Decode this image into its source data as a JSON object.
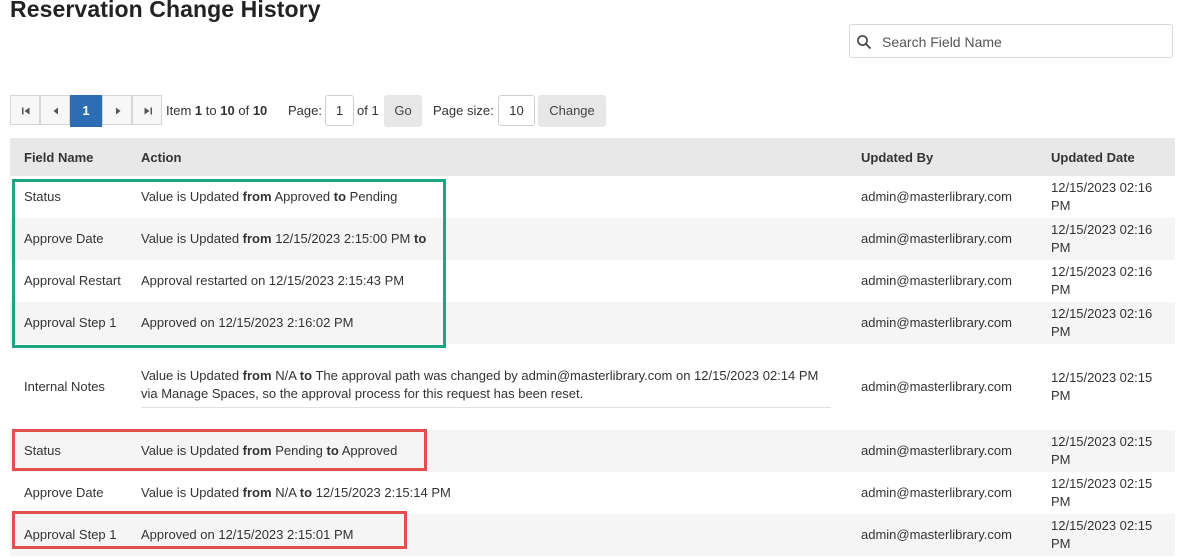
{
  "page": {
    "title": "Reservation Change History"
  },
  "search": {
    "placeholder": "Search Field Name",
    "icon": "search-icon"
  },
  "pager": {
    "current_page": "1",
    "item_label": "Item",
    "item_from": "1",
    "item_to_word": "to",
    "item_to": "10",
    "item_of_word": "of",
    "item_total": "10",
    "page_label": "Page:",
    "page_value": "1",
    "page_of": "of 1",
    "go_label": "Go",
    "size_label": "Page size:",
    "size_value": "10",
    "change_label": "Change"
  },
  "table": {
    "headers": {
      "field": "Field Name",
      "action": "Action",
      "by": "Updated By",
      "date": "Updated Date"
    },
    "rows": [
      {
        "field": "Status",
        "a1": "Value is Updated",
        "k1": "from",
        "a2": "Approved",
        "k2": "to",
        "a3": "Pending",
        "by": "admin@masterlibrary.com",
        "date": "12/15/2023 02:16 PM"
      },
      {
        "field": "Approve Date",
        "a1": "Value is Updated",
        "k1": "from",
        "a2": "12/15/2023 2:15:00 PM",
        "k2": "to",
        "a3": "",
        "by": "admin@masterlibrary.com",
        "date": "12/15/2023 02:16 PM"
      },
      {
        "field": "Approval Restart",
        "a1": "Approval restarted on 12/15/2023 2:15:43 PM",
        "by": "admin@masterlibrary.com",
        "date": "12/15/2023 02:16 PM"
      },
      {
        "field": "Approval Step 1",
        "a1": "Approved on 12/15/2023 2:16:02 PM",
        "by": "admin@masterlibrary.com",
        "date": "12/15/2023 02:16 PM"
      },
      {
        "field": "Internal Notes",
        "a1": "Value is Updated",
        "k1": "from",
        "a2": "N/A",
        "k2": "to",
        "a3": "The approval path was changed by admin@masterlibrary.com on 12/15/2023 02:14 PM via Manage Spaces, so the approval process for this request has been reset.",
        "by": "admin@masterlibrary.com",
        "date": "12/15/2023 02:15 PM"
      },
      {
        "field": "Status",
        "a1": "Value is Updated",
        "k1": "from",
        "a2": "Pending",
        "k2": "to",
        "a3": "Approved",
        "by": "admin@masterlibrary.com",
        "date": "12/15/2023 02:15 PM"
      },
      {
        "field": "Approve Date",
        "a1": "Value is Updated",
        "k1": "from",
        "a2": "N/A",
        "k2": "to",
        "a3": "12/15/2023 2:15:14 PM",
        "by": "admin@masterlibrary.com",
        "date": "12/15/2023 02:15 PM"
      },
      {
        "field": "Approval Step 1",
        "a1": "Approved on 12/15/2023 2:15:01 PM",
        "by": "admin@masterlibrary.com",
        "date": "12/15/2023 02:15 PM"
      }
    ]
  },
  "highlights": {
    "green": "#1fa583",
    "red": "#e0504e"
  },
  "colors": {
    "accent": "#2c6db3",
    "header_bg": "#e8e8e8"
  }
}
